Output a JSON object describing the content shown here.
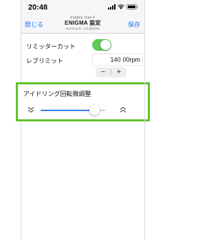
{
  "status_bar": {
    "time": "20:48",
    "icons": [
      "signal-icon",
      "wifi-icon",
      "battery-icon"
    ]
  },
  "nav": {
    "back_label": "閉じる",
    "save_label": "保存",
    "subtitle": "Enigma Type-F",
    "title": "ENIGMA 設定",
    "caption": "MARAMUSE 公式 認証済み"
  },
  "settings": {
    "limiter_cut": {
      "label": "リミッターカット",
      "enabled": true
    },
    "rev_limit": {
      "label": "レブリミット",
      "value": "140",
      "unit": "00rpm",
      "minus": "−",
      "plus": "+"
    },
    "idle_rpm": {
      "label": "アイドリング回転微調整",
      "slider_value": 0.82,
      "decrease_icon": "double-chevron-down-icon",
      "increase_icon": "double-chevron-up-icon"
    }
  },
  "colors": {
    "accent_blue": "#1a7cf4",
    "toggle_green": "#5ecb5a",
    "highlight_green": "#5ec32a",
    "slider_blue": "#2f7cf0"
  }
}
